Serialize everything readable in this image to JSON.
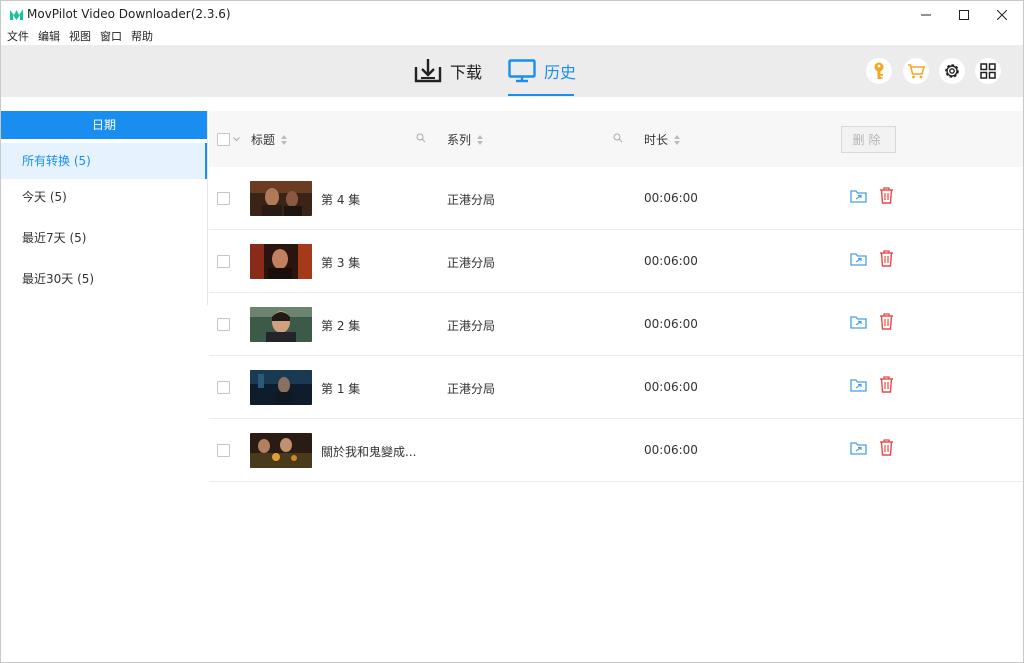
{
  "window": {
    "title": "MovPilot Video Downloader(2.3.6)"
  },
  "menu": [
    "文件",
    "编辑",
    "视图",
    "窗口",
    "帮助"
  ],
  "tabs": {
    "download": "下载",
    "history": "历史"
  },
  "header_icons": [
    "key-icon",
    "cart-icon",
    "gear-icon",
    "grid-icon"
  ],
  "sidebar": {
    "heading": "日期",
    "items": [
      {
        "label": "所有转换 (5)",
        "active": true
      },
      {
        "label": "今天 (5)",
        "active": false
      },
      {
        "label": "最近7天 (5)",
        "active": false
      },
      {
        "label": "最近30天 (5)",
        "active": false
      }
    ]
  },
  "table": {
    "columns": {
      "title": "标题",
      "series": "系列",
      "duration": "时长"
    },
    "delete_label": "删除",
    "rows": [
      {
        "title": "第 4 集",
        "series": "正港分局",
        "duration": "00:06:00"
      },
      {
        "title": "第 3 集",
        "series": "正港分局",
        "duration": "00:06:00"
      },
      {
        "title": "第 2 集",
        "series": "正港分局",
        "duration": "00:06:00"
      },
      {
        "title": "第 1 集",
        "series": "正港分局",
        "duration": "00:06:00"
      },
      {
        "title": "關於我和鬼變成...",
        "series": "",
        "duration": "00:06:00"
      }
    ]
  },
  "colors": {
    "accent": "#1a8ef0",
    "key_icon": "#f5a623",
    "cart_icon": "#f5a623",
    "folder_icon": "#4a9de8",
    "trash_icon": "#e84848"
  }
}
